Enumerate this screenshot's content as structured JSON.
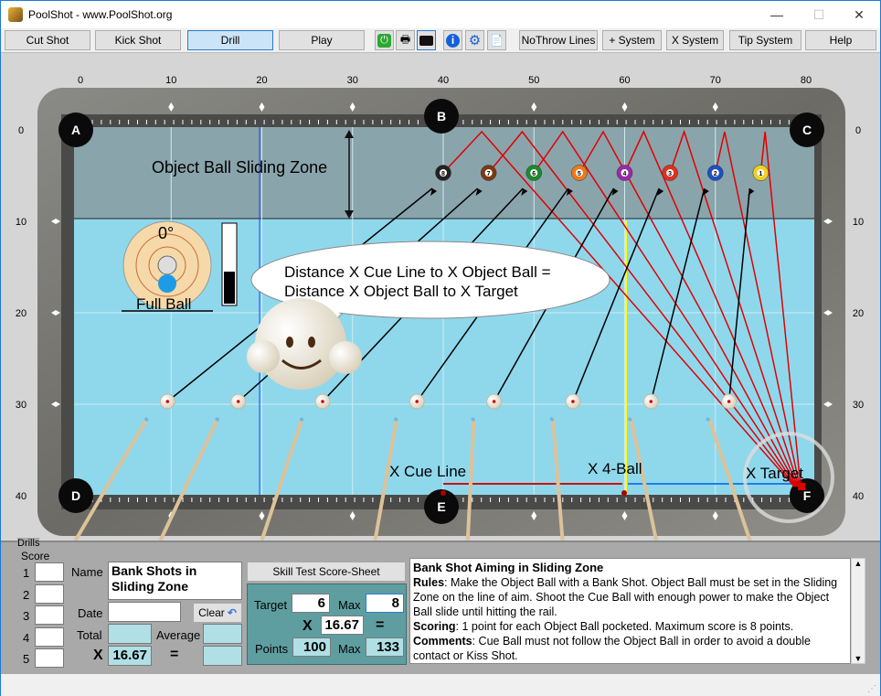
{
  "window": {
    "title": "PoolShot - www.PoolShot.org",
    "minimize": "—",
    "maximize": "☐",
    "close": "✕"
  },
  "toolbar": {
    "buttons": [
      {
        "label": "Cut Shot"
      },
      {
        "label": "Kick Shot"
      },
      {
        "label": "Drill",
        "selected": true
      },
      {
        "label": "Play"
      }
    ],
    "icons": [
      "power-icon",
      "printer-icon",
      "camera-icon",
      "info-icon",
      "gear-icon",
      "help-document-icon"
    ],
    "buttons2": [
      {
        "label": "NoThrow Lines"
      },
      {
        "label": "+ System"
      },
      {
        "label": "X System"
      },
      {
        "label": "Tip System"
      },
      {
        "label": "Help"
      }
    ]
  },
  "table": {
    "x_ticks": [
      "0",
      "10",
      "20",
      "30",
      "40",
      "50",
      "60",
      "70",
      "80"
    ],
    "y_ticks": [
      "0",
      "10",
      "20",
      "30",
      "40"
    ],
    "pockets": {
      "A": "A",
      "B": "B",
      "C": "C",
      "D": "D",
      "E": "E",
      "F": "F"
    },
    "sliding_zone_label": "Object Ball Sliding Zone",
    "angle_label": "0°",
    "full_ball_label": "Full Ball",
    "speech": [
      "Distance X Cue Line to X Object Ball =",
      "Distance X Object Ball to X Target"
    ],
    "x_cue_line": "X Cue Line",
    "x_4ball": "X 4-Ball",
    "x_target": "X Target",
    "object_balls": [
      {
        "n": "8",
        "x": 40,
        "y": 4.7,
        "color": "#222222"
      },
      {
        "n": "7",
        "x": 45,
        "y": 4.7,
        "color": "#7a3b12"
      },
      {
        "n": "6",
        "x": 50,
        "y": 4.7,
        "color": "#1a8a2a"
      },
      {
        "n": "5",
        "x": 55,
        "y": 4.7,
        "color": "#f07818"
      },
      {
        "n": "4",
        "x": 60,
        "y": 4.7,
        "color": "#9a2aa8"
      },
      {
        "n": "3",
        "x": 65,
        "y": 4.7,
        "color": "#e0301e"
      },
      {
        "n": "2",
        "x": 70,
        "y": 4.7,
        "color": "#2050c0"
      },
      {
        "n": "1",
        "x": 75,
        "y": 4.7,
        "color": "#f0d020"
      }
    ],
    "cue_balls_x": [
      9.6,
      17.4,
      26.7,
      37.1,
      45.6,
      54.3,
      62.9,
      71.5
    ],
    "cue_balls_y": 29.7,
    "target": {
      "x": 79.5,
      "y": 39
    }
  },
  "drills": {
    "group_label": "Drills",
    "score_label": "Score",
    "rows": [
      "1",
      "2",
      "3",
      "4",
      "5"
    ],
    "name_label": "Name",
    "name_value": "Bank Shots in Sliding Zone",
    "date_label": "Date",
    "date_value": "",
    "clear_label": "Clear",
    "total_label": "Total",
    "total_value": "",
    "average_label": "Average",
    "average_value": "",
    "x_label": "X",
    "x_value": "16.67",
    "eq": "=",
    "eq_value": "",
    "skill_button": "Skill Test Score-Sheet",
    "target_label": "Target",
    "target_value": "6",
    "max_label": "Max",
    "max_value": "8",
    "mult_value": "16.67",
    "points_label": "Points",
    "points_value": "100",
    "points_max": "133"
  },
  "description": {
    "title": "Bank Shot Aiming in Sliding Zone",
    "rules_label": "Rules",
    "rules": ": Make the Object Ball with a Bank Shot. Object Ball must be set in the Sliding Zone on the line of aim. Shoot the Cue Ball with enough power to make the Object Ball slide until hitting the rail.",
    "scoring_label": "Scoring",
    "scoring": ": 1 point for each Object Ball pocketed. Maximum score is 8 points.",
    "comments_label": "Comments",
    "comments": ": Cue Ball must not follow the Object Ball in order to avoid a double contact or Kiss Shot."
  }
}
